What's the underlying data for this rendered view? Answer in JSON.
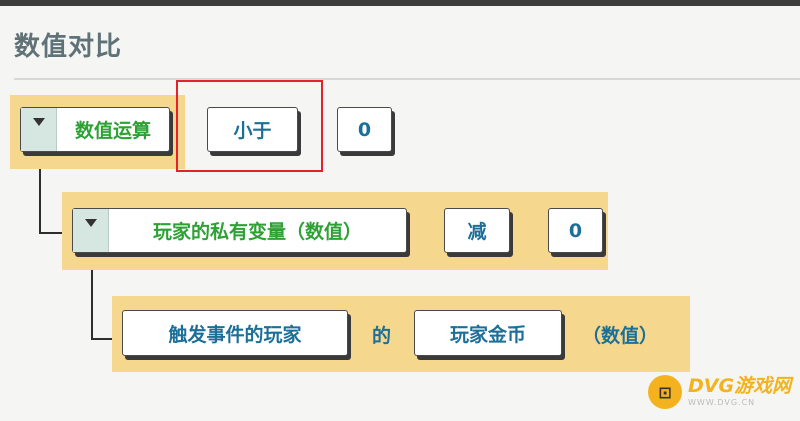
{
  "window": {
    "title": "数值对比"
  },
  "row1": {
    "dropdown_label": "数值运算",
    "operator": "小于",
    "value": "0"
  },
  "row2": {
    "dropdown_label": "玩家的私有变量（数值）",
    "operator": "减",
    "value": "0"
  },
  "row3": {
    "subject": "触发事件的玩家",
    "connector": "的",
    "property": "玩家金币",
    "suffix": "（数值）"
  },
  "watermark": {
    "brand": "DVG游戏网",
    "url": "WWW.DVG.CN"
  },
  "colors": {
    "title": "#5e7278",
    "label_blue": "#1c6f99",
    "label_green": "#2ea135",
    "strip": "#f5d88e",
    "highlight": "#e3232b"
  }
}
